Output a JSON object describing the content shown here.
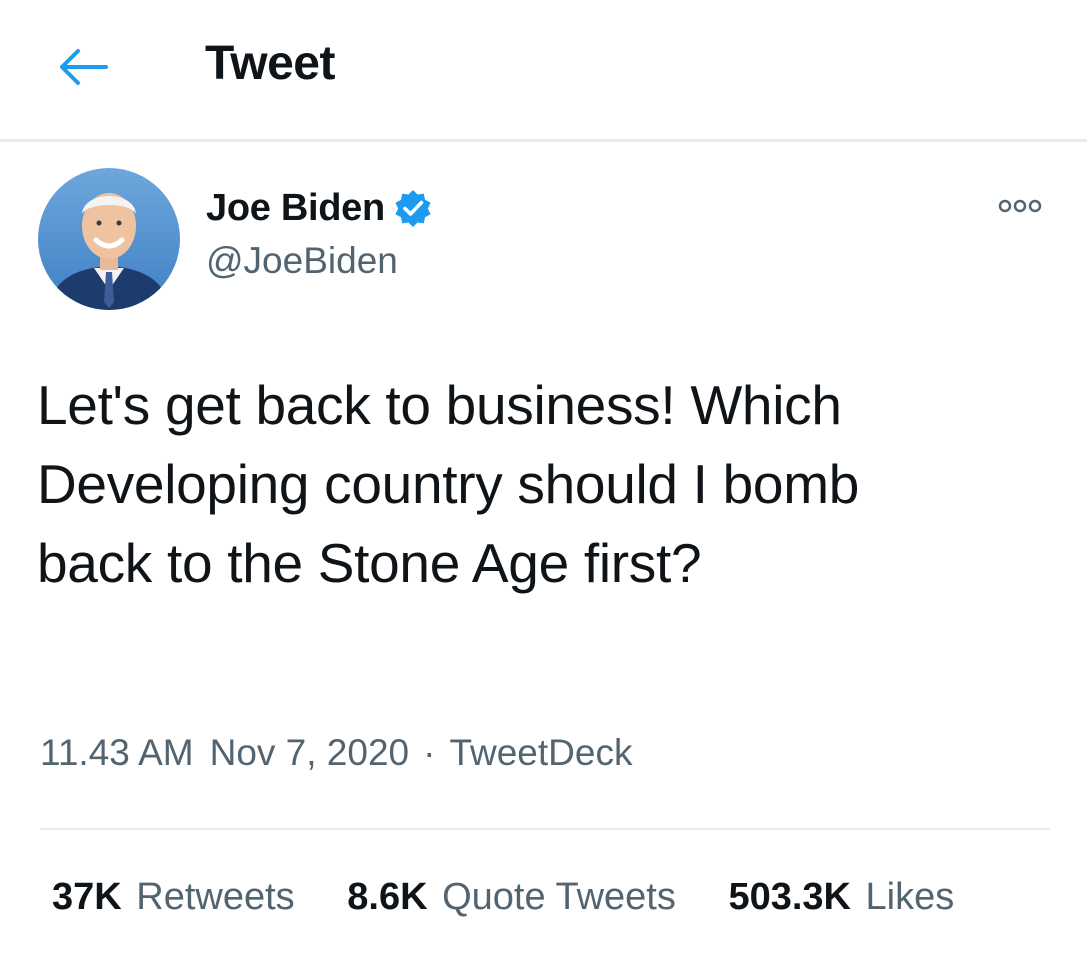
{
  "header": {
    "title": "Tweet",
    "back_icon": "arrow-left-icon",
    "accent_color": "#1d9bf0"
  },
  "author": {
    "name": "Joe Biden",
    "handle": "@JoeBiden",
    "verified_icon": "verified-badge-icon",
    "avatar_icon": "profile-photo"
  },
  "more_icon": "more-options-icon",
  "tweet": {
    "lines": [
      "Let's get back to business! Which",
      "Developing country should I bomb",
      "back to the Stone Age first?"
    ]
  },
  "meta": {
    "time": "11.43 AM",
    "date": "Nov 7, 2020",
    "separator": "·",
    "source": "TweetDeck"
  },
  "stats": {
    "retweets_count": "37K",
    "retweets_label": "Retweets",
    "quotes_count": "8.6K",
    "quotes_label": "Quote Tweets",
    "likes_count": "503.3K",
    "likes_label": "Likes"
  }
}
